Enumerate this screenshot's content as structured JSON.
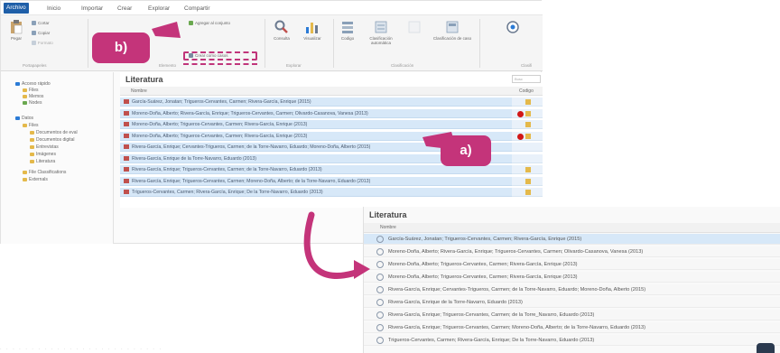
{
  "menu": {
    "tabs": [
      {
        "label": "Archivo",
        "active": true
      },
      {
        "label": "Inicio",
        "active": false
      },
      {
        "label": "Importar",
        "active": false
      },
      {
        "label": "Crear",
        "active": false
      },
      {
        "label": "Explorar",
        "active": false
      },
      {
        "label": "Compartir",
        "active": false
      }
    ]
  },
  "ribbon": {
    "paste": "Pegar",
    "cut": "Cortar",
    "copy": "Copiar",
    "format": "Formato",
    "clipboard_group": "Portapapeles",
    "add_to_set": "Agregar al conjunto",
    "create_as_cases": "Crear como casos",
    "item_group": "Elemento",
    "query": "Consulta",
    "visualize": "Visualizar",
    "explore_group": "Explorar",
    "code": "Codigo",
    "auto_classification": "Clasificación automática",
    "classification_group": "Clasificación",
    "cases_classification": "Clasificación de caso",
    "title_case_group": "Clasifi"
  },
  "nav": {
    "items": [
      {
        "label": "Acceso rápido",
        "color": "#2b7bd6",
        "indent": 0
      },
      {
        "label": "Files",
        "color": "#e4b94b",
        "indent": 1
      },
      {
        "label": "Memos",
        "color": "#e4b94b",
        "indent": 1
      },
      {
        "label": "Nodes",
        "color": "#6aa84f",
        "indent": 1
      },
      {
        "label": "Datos",
        "color": "#2b7bd6",
        "indent": 0
      },
      {
        "label": "Files",
        "color": "#e4b94b",
        "indent": 1
      },
      {
        "label": "Documentos de eval",
        "color": "#e4b94b",
        "indent": 2
      },
      {
        "label": "Documentos digital",
        "color": "#e4b94b",
        "indent": 2
      },
      {
        "label": "Entrevistas",
        "color": "#e4b94b",
        "indent": 2
      },
      {
        "label": "Imágenes",
        "color": "#e4b94b",
        "indent": 2
      },
      {
        "label": "Literatura",
        "color": "#e4b94b",
        "indent": 2
      },
      {
        "label": "File Classifications",
        "color": "#e4b94b",
        "indent": 1
      },
      {
        "label": "Externals",
        "color": "#e4b94b",
        "indent": 1
      }
    ]
  },
  "list_panel": {
    "title": "Literatura",
    "search_placeholder": "Busc",
    "col_name": "Nombre",
    "col_code": "Codigo",
    "rows": [
      {
        "text": "García-Suárez, Jonatan; Trigueros-Cervantes, Carmen; Rivera-García, Enrique (2015)",
        "red": false,
        "marker": true
      },
      {
        "text": "Moreno-Doña, Alberto; Rivera-García, Enrique; Trigueros-Cervantes, Carmen; Olivardo-Casanova, Vanesa (2013)",
        "red": true,
        "marker": true
      },
      {
        "text": "Moreno-Doña, Alberto; Trigueros-Cervantes, Carmen; Rivera-García, Enrique (2013)",
        "red": false,
        "marker": true
      },
      {
        "text": "Moreno-Doña, Alberto; Trigueros-Cervantes, Carmen; Rivera-García, Enrique (2013)",
        "red": true,
        "marker": true
      },
      {
        "text": "Rivera-García, Enrique; Cervantes-Trigueros, Carmen; de la Torre-Navarro, Eduardo; Moreno-Doña, Alberto (2015)",
        "red": false,
        "marker": false
      },
      {
        "text": "Rivera-García, Enrique de la Torre-Navarro, Eduardo (2013)",
        "red": false,
        "marker": false
      },
      {
        "text": "Rivera-García, Enrique; Trigueros-Cervantes, Carmen; de la Torre-Navarro, Eduardo (2013)",
        "red": false,
        "marker": true
      },
      {
        "text": "Rivera-García, Enrique; Trigueros-Cervantes, Carmen; Moreno-Doña, Alberto; de la Torre-Navarro, Eduardo (2013)",
        "red": false,
        "marker": true
      },
      {
        "text": "Trigueros-Cervantes, Carmen; Rivera-García, Enrique; De la Torre-Navarro, Eduardo (2013)",
        "red": false,
        "marker": true
      }
    ]
  },
  "annotations": {
    "label_a": "a)",
    "label_b": "b)",
    "accent": "#c4347a"
  },
  "zoom_panel": {
    "title": "Literatura",
    "col_name": "Nombre",
    "rows": [
      "García-Suárez, Jonatan; Trigueros-Cervantes, Carmen; Rivera-García, Enrique (2015)",
      "Moreno-Doña, Alberto; Rivera-García, Enrique; Trigueros-Cervantes, Carmen; Olivardo-Casanova, Vanesa (2013)",
      "Moreno-Doña, Alberto; Trigueros-Cervantes, Carmen; Rivera-García, Enrique (2013)",
      "Moreno-Doña, Alberto; Trigueros-Cervantes, Carmen; Rivera-García, Enrique (2013)",
      "Rivera-García, Enrique; Cervantes-Trigueros, Carmen; de la Torre-Navarro, Eduardo; Moreno-Doña, Alberto (2015)",
      "Rivera-García, Enrique de la Torre-Navarro, Eduardo (2013)",
      "Rivera-García, Enrique; Trigueros-Cervantes, Carmen; de la Torre_Navarro, Eduardo (2013)",
      "Rivera-García, Enrique; Trigueros-Cervantes, Carmen; Moreno-Doña, Alberto; de la Torre-Navarro, Eduardo (2013)",
      "Trigueros-Cervantes, Carmen; Rivera-García, Enrique; De la Torre-Navarro, Eduardo (2013)"
    ]
  },
  "colors": {
    "selection": "#d7e8f8",
    "ribbon_active": "#1f5fa8",
    "marker": "#e4b94b",
    "red_dot": "#d11717"
  }
}
